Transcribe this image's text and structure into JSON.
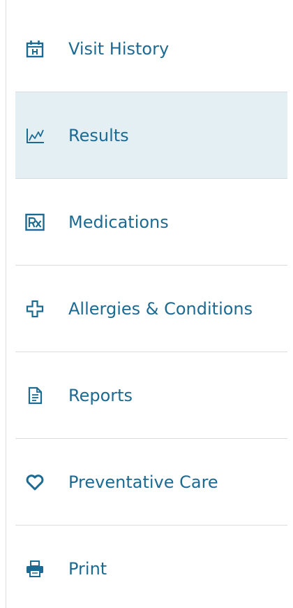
{
  "accent_color": "#1c6a91",
  "active_background": "#e3eff2",
  "nav": {
    "items": [
      {
        "label": "Visit History",
        "icon": "hospital-calendar-icon",
        "active": false
      },
      {
        "label": "Results",
        "icon": "line-chart-icon",
        "active": true
      },
      {
        "label": "Medications",
        "icon": "rx-icon",
        "active": false
      },
      {
        "label": "Allergies & Conditions",
        "icon": "medical-cross-icon",
        "active": false
      },
      {
        "label": "Reports",
        "icon": "document-icon",
        "active": false
      },
      {
        "label": "Preventative Care",
        "icon": "heart-icon",
        "active": false
      },
      {
        "label": "Print",
        "icon": "printer-icon",
        "active": false
      }
    ]
  }
}
